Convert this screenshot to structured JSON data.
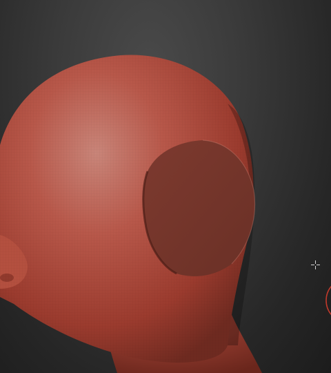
{
  "viewport": {
    "background_color": "#2f2f2f",
    "material_color": "#b5493a",
    "highlight_color": "#d4897e",
    "flattened_patch_color": "#7a3a2e",
    "brush_ring_color": "#c0392b"
  },
  "icons": {
    "cursor": "crosshair-cursor-icon",
    "brush": "brush-ring-icon"
  }
}
